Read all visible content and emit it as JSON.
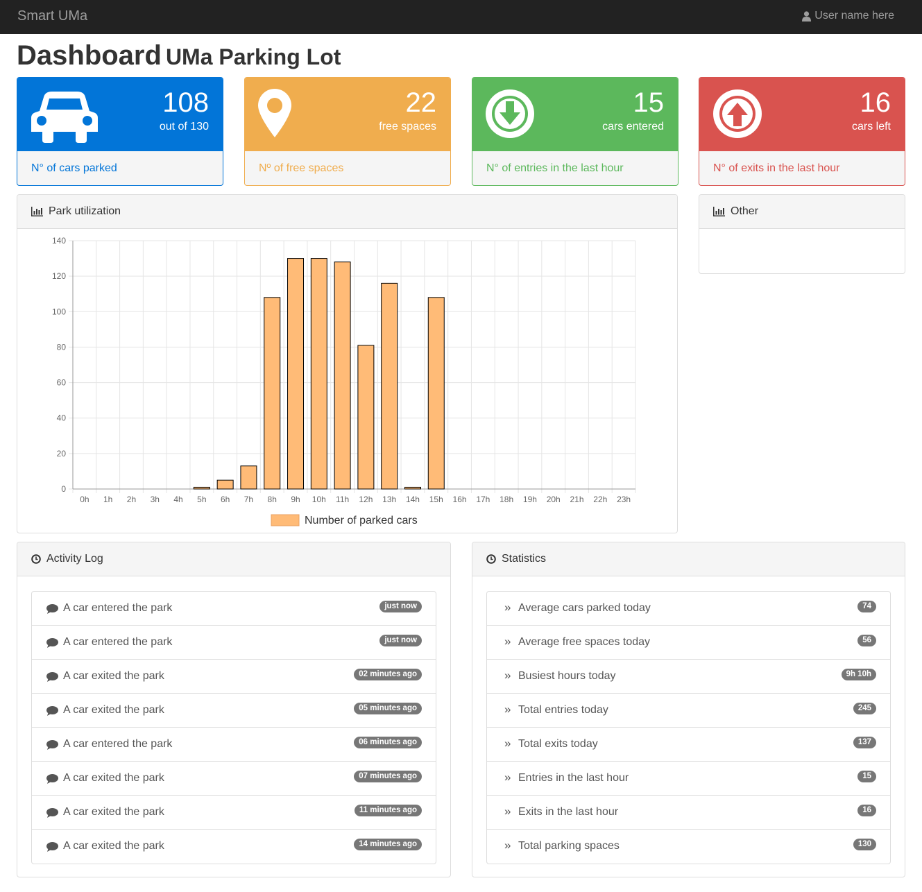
{
  "navbar": {
    "brand": "Smart UMa",
    "user_name": "User name here",
    "user_icon": "user-icon"
  },
  "header": {
    "title": "Dashboard",
    "subtitle": "UMa Parking Lot"
  },
  "cards": [
    {
      "value": "108",
      "sub": "out of 130",
      "footer": "N° of cars parked",
      "icon": "car-icon",
      "color": "#0275d8"
    },
    {
      "value": "22",
      "sub": "free spaces",
      "footer": "Nº of free spaces",
      "icon": "map-marker-icon",
      "color": "#f0ad4e"
    },
    {
      "value": "15",
      "sub": "cars entered",
      "footer": "N° of entries in the last hour",
      "icon": "arrow-circle-down-icon",
      "color": "#5cb85c"
    },
    {
      "value": "16",
      "sub": "cars left",
      "footer": "N° of exits in the last hour",
      "icon": "arrow-circle-up-icon",
      "color": "#d9534f"
    }
  ],
  "utilization": {
    "title": "Park utilization",
    "icon": "bar-chart-icon"
  },
  "other": {
    "title": "Other",
    "icon": "bar-chart-icon"
  },
  "chart_data": {
    "type": "bar",
    "categories": [
      "0h",
      "1h",
      "2h",
      "3h",
      "4h",
      "5h",
      "6h",
      "7h",
      "8h",
      "9h",
      "10h",
      "11h",
      "12h",
      "13h",
      "14h",
      "15h",
      "16h",
      "17h",
      "18h",
      "19h",
      "20h",
      "21h",
      "22h",
      "23h"
    ],
    "series": [
      {
        "name": "Number of parked cars",
        "values": [
          0,
          0,
          0,
          0,
          0,
          1,
          5,
          13,
          108,
          130,
          130,
          128,
          81,
          116,
          1,
          108,
          0,
          0,
          0,
          0,
          0,
          0,
          0,
          0
        ]
      }
    ],
    "ylim": [
      0,
      140
    ],
    "yticks": [
      0,
      20,
      40,
      60,
      80,
      100,
      120,
      140
    ],
    "grid": true,
    "legend": "bottom",
    "bar_color": "#ffbb77",
    "bar_border": "#000000"
  },
  "activity_log": {
    "title": "Activity Log",
    "icon": "clock-icon",
    "items": [
      {
        "text": "A car entered the park",
        "time": "just now"
      },
      {
        "text": "A car entered the park",
        "time": "just now"
      },
      {
        "text": "A car exited the park",
        "time": "02 minutes ago"
      },
      {
        "text": "A car exited the park",
        "time": "05 minutes ago"
      },
      {
        "text": "A car entered the park",
        "time": "06 minutes ago"
      },
      {
        "text": "A car exited the park",
        "time": "07 minutes ago"
      },
      {
        "text": "A car exited the park",
        "time": "11 minutes ago"
      },
      {
        "text": "A car exited the park",
        "time": "14 minutes ago"
      }
    ]
  },
  "statistics": {
    "title": "Statistics",
    "icon": "clock-icon",
    "items": [
      {
        "label": "Average cars parked today",
        "value": "74"
      },
      {
        "label": "Average free spaces today",
        "value": "56"
      },
      {
        "label": "Busiest hours today",
        "value": "9h 10h"
      },
      {
        "label": "Total entries today",
        "value": "245"
      },
      {
        "label": "Total exits today",
        "value": "137"
      },
      {
        "label": "Entries in the last hour",
        "value": "15"
      },
      {
        "label": "Exits in the last hour",
        "value": "16"
      },
      {
        "label": "Total parking spaces",
        "value": "130"
      }
    ]
  }
}
